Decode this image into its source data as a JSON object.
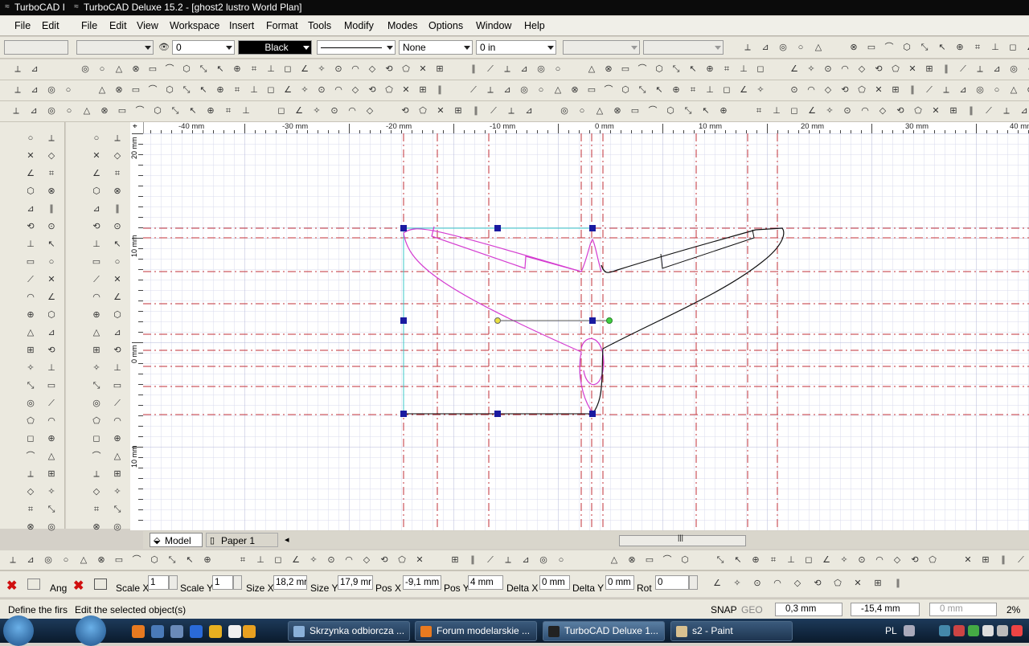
{
  "window": {
    "left_title": "TurboCAD I",
    "title": "TurboCAD Deluxe 15.2 - [ghost2 lustro World Plan]"
  },
  "menubar": {
    "left_items": [
      "File",
      "Edit"
    ],
    "items": [
      "File",
      "Edit",
      "View",
      "Workspace",
      "Insert",
      "Format",
      "Tools",
      "Modify",
      "Modes",
      "Options",
      "Window",
      "Help"
    ]
  },
  "property_toolbar": {
    "layer_value": "0",
    "color_value": "Black",
    "fill_value": "None",
    "width_value": "0 in"
  },
  "ruler": {
    "h_labels": [
      "-40 mm",
      "-30 mm",
      "-20 mm",
      "-10 mm",
      "0 mm",
      "10 mm",
      "20 mm",
      "30 mm",
      "40 mm"
    ],
    "v_labels": [
      "20 mm",
      "10 mm",
      "0 mm",
      "10 mm"
    ]
  },
  "tabs": {
    "model": "Model",
    "paper": "Paper 1"
  },
  "inspector": {
    "ang_label": "Ang",
    "scale_x_label": "Scale X",
    "scale_x": "1",
    "scale_y_label": "Scale Y",
    "scale_y": "1",
    "size_x_label": "Size X",
    "size_x": "18,2 mr",
    "size_y_label": "Size Y",
    "size_y": "17,9 mr",
    "pos_x_label": "Pos X",
    "pos_x": "-9,1 mm",
    "pos_y_label": "Pos Y",
    "pos_y": "4 mm",
    "delta_x_label": "Delta X",
    "delta_x": "0 mm",
    "delta_y_label": "Delta Y",
    "delta_y": "0 mm",
    "rot_label": "Rot",
    "rot": "0"
  },
  "status": {
    "left_prompt": "Define the firs",
    "prompt": "Edit the selected object(s)",
    "snap": "SNAP",
    "geo": "GEO",
    "coord_x": "0,3 mm",
    "coord_y": "-15,4 mm",
    "coord_z": "0 mm",
    "zoom": "2%"
  },
  "taskbar": {
    "tasks": [
      "Skrzynka odbiorcza ...",
      "Forum modelarskie ...",
      "TurboCAD Deluxe 1...",
      "s2 - Paint"
    ],
    "lang": "PL"
  },
  "colors": {
    "guide_line": "#c0303a",
    "profile_magenta": "#d43cd0",
    "handle_blue": "#1a1aa0",
    "grid": "#c8cce4"
  }
}
